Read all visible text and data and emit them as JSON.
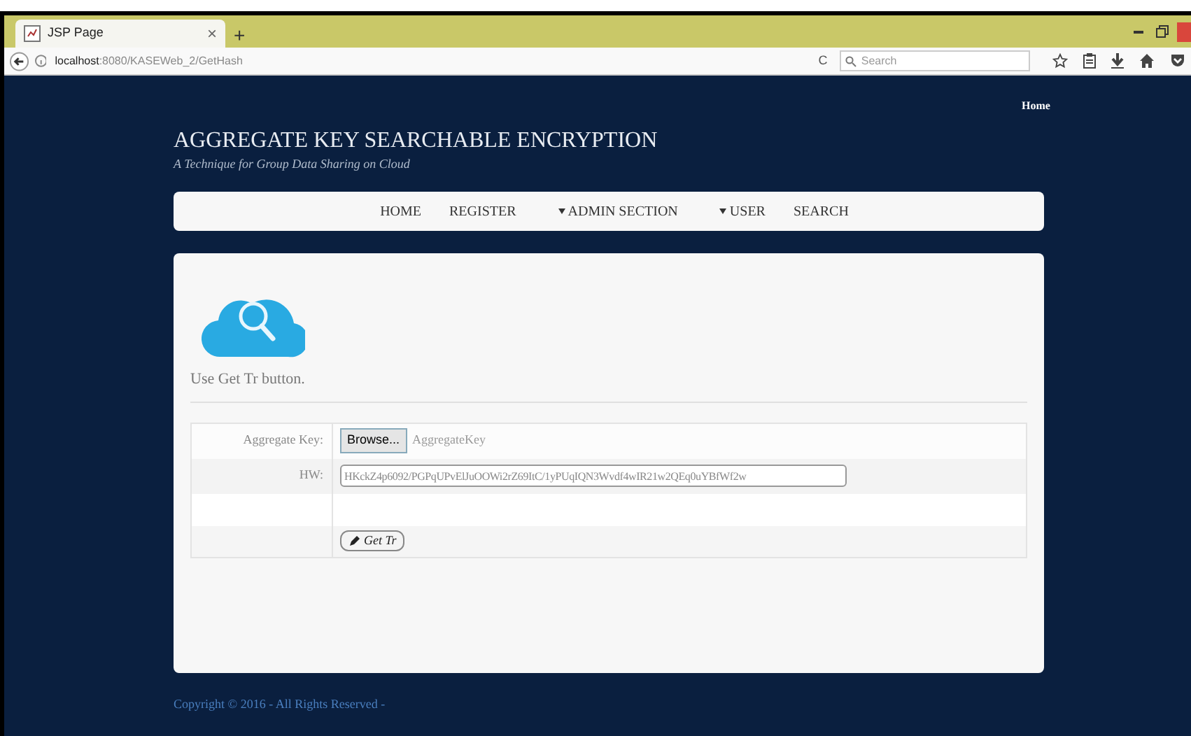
{
  "browser": {
    "tab": {
      "title": "JSP Page",
      "close": "×"
    },
    "new_tab": "+",
    "url": {
      "host": "localhost",
      "rest": ":8080/KASEWeb_2/GetHash"
    },
    "reload": "C",
    "search_placeholder": "Search"
  },
  "site": {
    "top_link": "Home",
    "title": "AGGREGATE KEY SEARCHABLE ENCRYPTION",
    "subtitle": "A Technique for Group Data Sharing on Cloud",
    "nav": [
      {
        "label": "HOME",
        "dropdown": false
      },
      {
        "label": "REGISTER",
        "dropdown": false
      },
      {
        "label": "ADMIN SECTION",
        "dropdown": true
      },
      {
        "label": "USER",
        "dropdown": true
      },
      {
        "label": "SEARCH",
        "dropdown": false
      }
    ],
    "intro": "Use Get Tr button.",
    "form": {
      "aggregate_key": {
        "label": "Aggregate Key:",
        "button": "Browse...",
        "file_name": "AggregateKey"
      },
      "hw": {
        "label": "HW:",
        "value": "HKckZ4p6092/PGPqUPvElJuOOWi2rZ69ItC/1yPUqIQN3Wvdf4wIR21w2QEq0uYBfWf2w"
      },
      "submit": "Get Tr"
    },
    "footer": "Copyright © 2016 - All Rights Reserved -"
  }
}
